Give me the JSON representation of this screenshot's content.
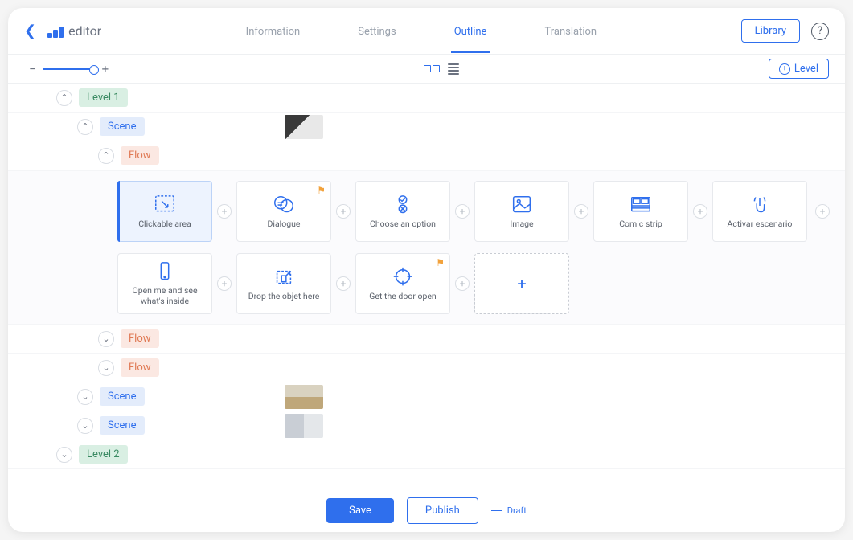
{
  "logo_text": "editor",
  "top_nav": {
    "information": "Information",
    "settings": "Settings",
    "outline": "Outline",
    "translation": "Translation"
  },
  "library_btn": "Library",
  "add_level_btn": "Level",
  "tree": {
    "level1": "Level 1",
    "scene": "Scene",
    "flow": "Flow",
    "level2": "Level 2"
  },
  "cards": {
    "clickable_area": "Clickable area",
    "dialogue": "Dialogue",
    "choose_option": "Choose an option",
    "image": "Image",
    "comic_strip": "Comic strip",
    "activar_escenario": "Activar escenario",
    "open_me": "Open me and see what's inside",
    "drop_here": "Drop the objet here",
    "get_door": "Get the door open"
  },
  "footer": {
    "save": "Save",
    "publish": "Publish",
    "draft": "Draft"
  }
}
